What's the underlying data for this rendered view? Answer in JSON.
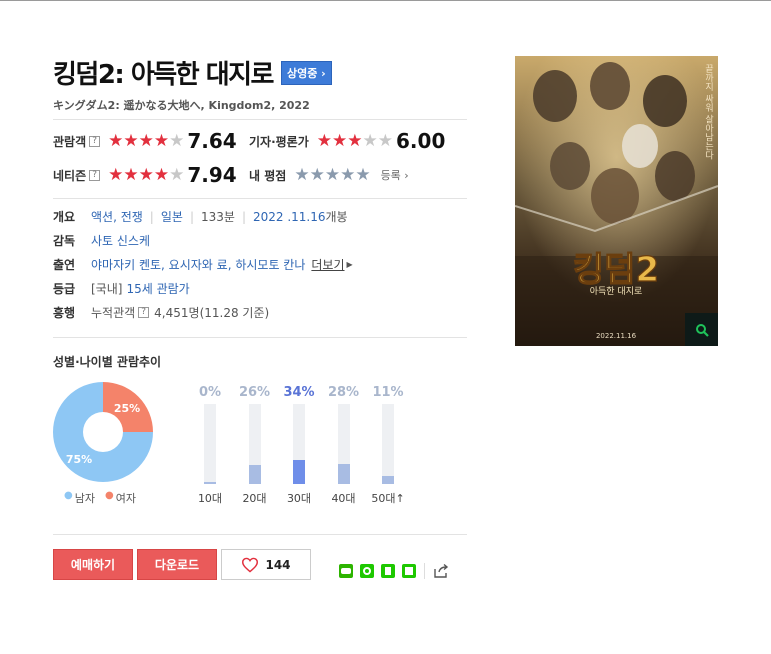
{
  "movie": {
    "title": "킹덤2: 아득한 대지로",
    "status_badge": "상영중 ›",
    "original_title": "キングダム2: 遥かなる大地へ, Kingdom2, 2022"
  },
  "ratings": {
    "audience": {
      "label": "관람객",
      "help": "?",
      "score": "7.64",
      "stars": 4
    },
    "critic": {
      "label": "기자·평론가",
      "score": "6.00",
      "stars": 3
    },
    "netizen": {
      "label": "네티즌",
      "help": "?",
      "score": "7.94",
      "stars": 4
    },
    "mine": {
      "label": "내 평점",
      "register": "등록 ›"
    }
  },
  "info": {
    "overview_label": "개요",
    "genre": "액션, 전쟁",
    "country": "일본",
    "runtime": "133분",
    "release_date": "2022 .11.16",
    "release_suffix": "개봉",
    "director_label": "감독",
    "director": "사토 신스케",
    "cast_label": "출연",
    "cast": "야마자키 켄토, 요시자와 료, 하시모토 칸나",
    "cast_more": "더보기",
    "grade_label": "등급",
    "grade_prefix": "[국내]",
    "grade": "15세 관람가",
    "boxoffice_label": "흥행",
    "boxoffice_prefix": "누적관객",
    "boxoffice_help": "?",
    "boxoffice": "4,451명(11.28 기준)"
  },
  "trend": {
    "title": "성별·나이별 관람추이",
    "gender": {
      "male_label": "남자",
      "male_pct": "75%",
      "male_value": 75,
      "female_label": "여자",
      "female_pct": "25%",
      "female_value": 25,
      "male_color": "#8ec7f4",
      "female_color": "#f4836a"
    },
    "ages": [
      {
        "label": "10대",
        "pct": "0%",
        "value": 0
      },
      {
        "label": "20대",
        "pct": "26%",
        "value": 26
      },
      {
        "label": "30대",
        "pct": "34%",
        "value": 34
      },
      {
        "label": "40대",
        "pct": "28%",
        "value": 28
      },
      {
        "label": "50대↑",
        "pct": "11%",
        "value": 11
      }
    ]
  },
  "actions": {
    "reserve": "예매하기",
    "download": "다운로드",
    "like_count": "144"
  },
  "poster": {
    "title": "킹덤2",
    "subtitle": "아득한 대지로",
    "date": "2022.11.16",
    "side_text": "끝까지 싸워 살아남는다"
  }
}
